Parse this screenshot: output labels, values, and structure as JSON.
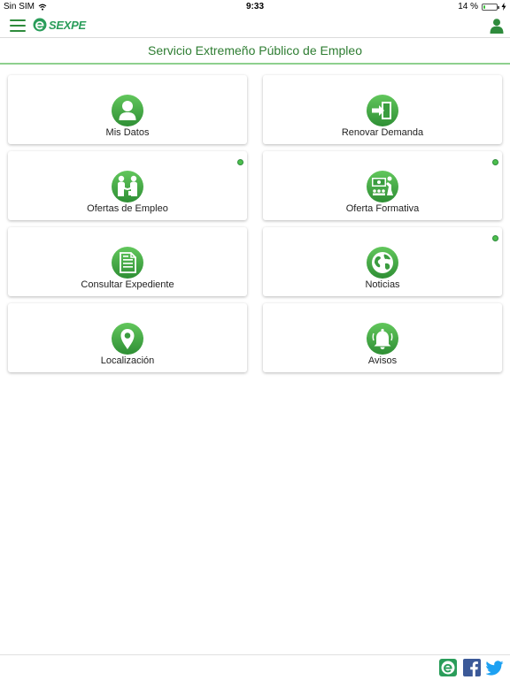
{
  "status_bar": {
    "carrier": "Sin SIM",
    "time": "9:33",
    "battery_text": "14 %",
    "battery_level": 0.14
  },
  "nav": {
    "logo_text": "SEXPE",
    "menu_icon": "hamburger-menu-icon",
    "user_icon": "user-icon"
  },
  "header": {
    "title": "Servicio Extremeño Público de Empleo"
  },
  "tiles": [
    {
      "label": "Mis Datos",
      "icon": "person-icon",
      "badge": false
    },
    {
      "label": "Renovar Demanda",
      "icon": "door-enter-icon",
      "badge": false
    },
    {
      "label": "Ofertas de Empleo",
      "icon": "handshake-icon",
      "badge": true
    },
    {
      "label": "Oferta Formativa",
      "icon": "classroom-icon",
      "badge": true
    },
    {
      "label": "Consultar Expediente",
      "icon": "document-icon",
      "badge": false
    },
    {
      "label": "Noticias",
      "icon": "globe-icon",
      "badge": true
    },
    {
      "label": "Localización",
      "icon": "location-pin-icon",
      "badge": false
    },
    {
      "label": "Avisos",
      "icon": "bell-icon",
      "badge": false
    }
  ],
  "footer": {
    "social": [
      "sexpe-icon",
      "facebook-icon",
      "twitter-icon"
    ]
  },
  "colors": {
    "brand_green": "#2e8b3c",
    "icon_green_light": "#5cc05a",
    "icon_green_dark": "#2f8f35",
    "title_green": "#2e7d32",
    "facebook_blue": "#3b5998",
    "twitter_blue": "#1da1f2"
  }
}
